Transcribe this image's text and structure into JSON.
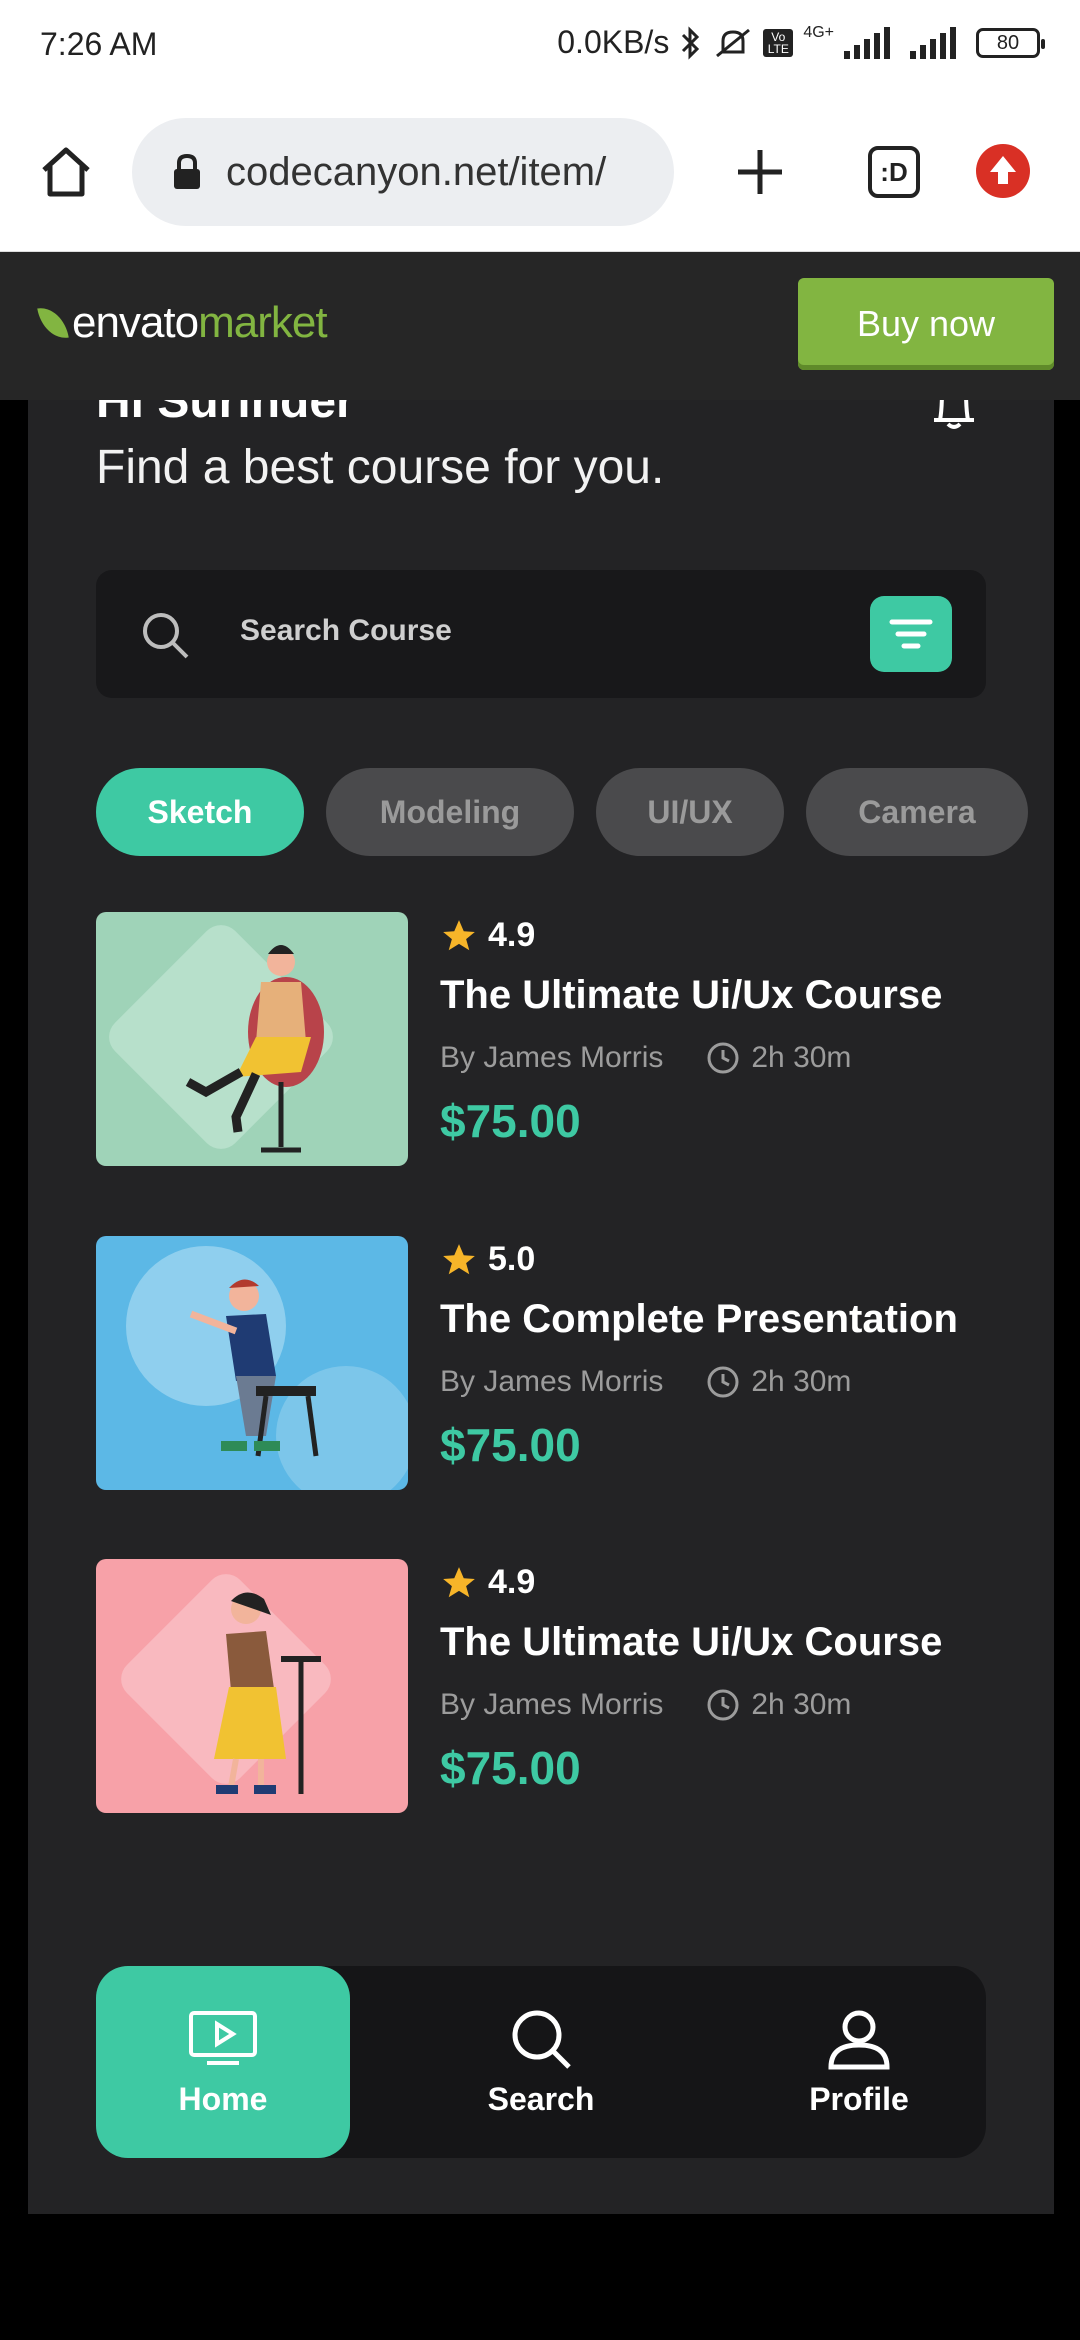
{
  "status": {
    "time": "7:26 AM",
    "network_speed": "0.0KB/s",
    "lte": "Vo LTE",
    "network_type": "4G+",
    "battery": "80"
  },
  "browser": {
    "url": "codecanyon.net/item/",
    "tabs_label": ":D"
  },
  "envato": {
    "logo_part1": "envato",
    "logo_part2": "market",
    "buy_label": "Buy now",
    "brand_color": "#82b541"
  },
  "app": {
    "greeting": "Hi Surinder",
    "subtitle": "Find a best course for you.",
    "search_placeholder": "Search Course",
    "accent_color": "#3ec9a3",
    "categories": [
      {
        "label": "Sketch",
        "active": true
      },
      {
        "label": "Modeling",
        "active": false
      },
      {
        "label": "UI/UX",
        "active": false
      },
      {
        "label": "Camera",
        "active": false
      }
    ],
    "courses": [
      {
        "rating": "4.9",
        "title": "The Ultimate Ui/Ux Course",
        "author": "By James Morris",
        "duration": "2h 30m",
        "price": "$75.00",
        "thumb_color": "#9fd3b8"
      },
      {
        "rating": "5.0",
        "title": "The Complete Presentation",
        "author": "By James Morris",
        "duration": "2h 30m",
        "price": "$75.00",
        "thumb_color": "#5cb8e6"
      },
      {
        "rating": "4.9",
        "title": "The Ultimate Ui/Ux Course",
        "author": "By James Morris",
        "duration": "2h 30m",
        "price": "$75.00",
        "thumb_color": "#f7a1a8"
      }
    ],
    "nav": [
      {
        "label": "Home",
        "icon": "tv-play-icon",
        "active": true
      },
      {
        "label": "Search",
        "icon": "search-icon",
        "active": false
      },
      {
        "label": "Profile",
        "icon": "user-icon",
        "active": false
      }
    ]
  }
}
